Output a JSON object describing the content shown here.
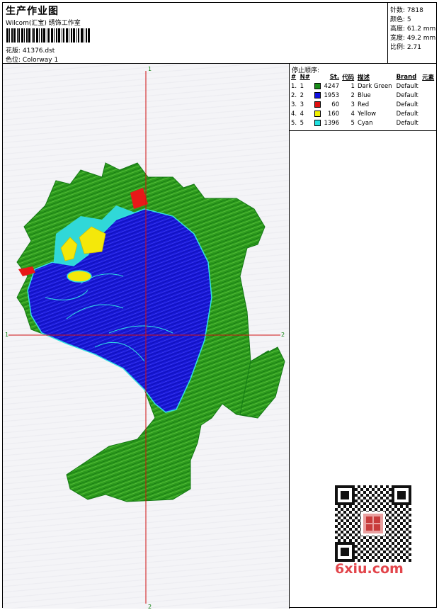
{
  "header": {
    "title": "生产作业图",
    "company": "Wilcom(汇宝) 绣饰工作室",
    "design": "花版: 41376.dst",
    "colorway": "色位: Colorway 1"
  },
  "stats": {
    "stitches": "针数: 7818",
    "colors": "颜色: 5",
    "height": "高度: 61.2 mm",
    "width": "宽度: 49.2 mm",
    "scale": "比例: 2.71"
  },
  "axes": {
    "top_label": "1",
    "bottom_label": "2",
    "left_label": "1",
    "right_label": "2"
  },
  "stop_sequence": {
    "header": "停止顺序:",
    "columns": [
      "#",
      "N#",
      "St.",
      "代码",
      "描述",
      "Brand",
      "元素"
    ],
    "rows": [
      {
        "index": "1.",
        "n": "1",
        "color": "#1a8c1a",
        "stitches": "4247",
        "code": "1",
        "desc": "Dark Green",
        "brand": "Default"
      },
      {
        "index": "2.",
        "n": "2",
        "color": "#1010e0",
        "stitches": "1953",
        "code": "2",
        "desc": "Blue",
        "brand": "Default"
      },
      {
        "index": "3.",
        "n": "3",
        "color": "#e01010",
        "stitches": "60",
        "code": "3",
        "desc": "Red",
        "brand": "Default"
      },
      {
        "index": "4.",
        "n": "4",
        "color": "#f0f000",
        "stitches": "160",
        "code": "4",
        "desc": "Yellow",
        "brand": "Default"
      },
      {
        "index": "5.",
        "n": "5",
        "color": "#20e0e0",
        "stitches": "1396",
        "code": "5",
        "desc": "Cyan",
        "brand": "Default"
      }
    ]
  },
  "watermark": "6xiu.com"
}
